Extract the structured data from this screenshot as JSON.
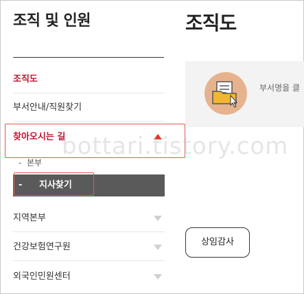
{
  "sidebar": {
    "title": "조직 및 인원",
    "items": [
      {
        "label": "조직도",
        "state": "current"
      },
      {
        "label": "부서안내/직원찾기",
        "state": "normal"
      },
      {
        "label": "찾아오시는 길",
        "state": "expanded"
      },
      {
        "label": "지역본부",
        "state": "collapsed"
      },
      {
        "label": "건강보험연구원",
        "state": "collapsed"
      },
      {
        "label": "외국인민원센터",
        "state": "collapsed"
      }
    ],
    "submenu": [
      {
        "label": "본부",
        "prefix": "-"
      },
      {
        "label": "지사찾기",
        "prefix": "-",
        "active": true
      }
    ]
  },
  "main": {
    "title": "조직도",
    "info_text": "부서명을 클",
    "auditor_button": "상임감사"
  },
  "watermark": "bottari.tistory.com",
  "colors": {
    "accent_red": "#c8102e",
    "arrow_red": "#e8332a",
    "highlight_box": "#e35a4d",
    "active_bg": "#5a5a5a",
    "icon_circle": "#e6b38e",
    "folder": "#f2b632"
  }
}
